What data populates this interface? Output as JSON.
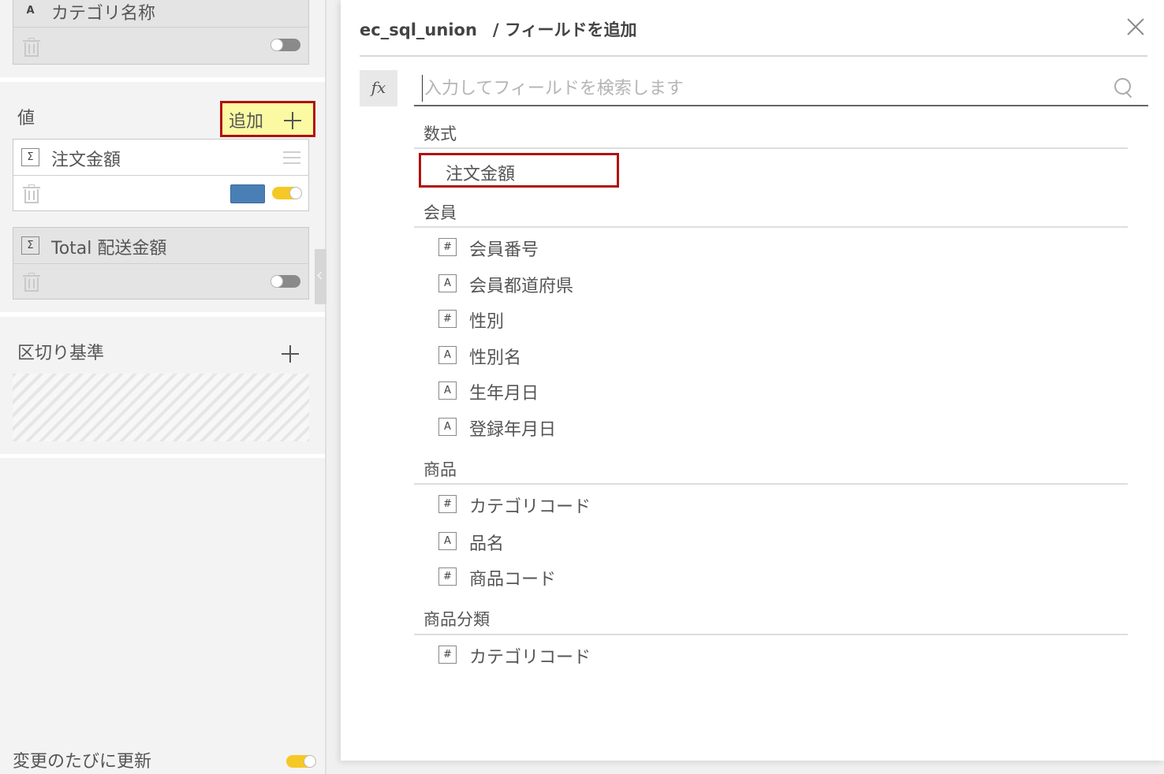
{
  "left": {
    "top_field": {
      "type": "A",
      "label": "カテゴリ名称",
      "toggle_on": false
    },
    "values_section": {
      "title": "値",
      "add_label": "追加",
      "fields": [
        {
          "type": "Σ",
          "label": "注文金額",
          "toggle_on": true,
          "color": "#4a7fb5"
        },
        {
          "type": "Σ",
          "label": "Total 配送金額",
          "toggle_on": false
        }
      ]
    },
    "split_section": {
      "title": "区切り基準"
    },
    "footer": {
      "label": "変更のたびに更新",
      "toggle_on": true
    }
  },
  "dialog": {
    "dataset": "ec_sql_union",
    "title": "/ フィールドを追加",
    "fx_label": "fx",
    "search_placeholder": "入力してフィールドを検索します",
    "search_value": "",
    "groups": [
      {
        "name": "数式",
        "items": [
          {
            "type": "",
            "label": "注文金額"
          }
        ]
      },
      {
        "name": "会員",
        "items": [
          {
            "type": "#",
            "label": "会員番号"
          },
          {
            "type": "A",
            "label": "会員都道府県"
          },
          {
            "type": "#",
            "label": "性別"
          },
          {
            "type": "A",
            "label": "性別名"
          },
          {
            "type": "A",
            "label": "生年月日"
          },
          {
            "type": "A",
            "label": "登録年月日"
          }
        ]
      },
      {
        "name": "商品",
        "items": [
          {
            "type": "#",
            "label": "カテゴリコード"
          },
          {
            "type": "A",
            "label": "品名"
          },
          {
            "type": "#",
            "label": "商品コード"
          }
        ]
      },
      {
        "name": "商品分類",
        "items": [
          {
            "type": "#",
            "label": "カテゴリコード"
          }
        ]
      }
    ]
  },
  "colors": {
    "highlight_border": "#b01010",
    "highlight_fill": "#fbfaa3",
    "toggle_on": "#f6c825",
    "swatch": "#4a7fb5"
  }
}
